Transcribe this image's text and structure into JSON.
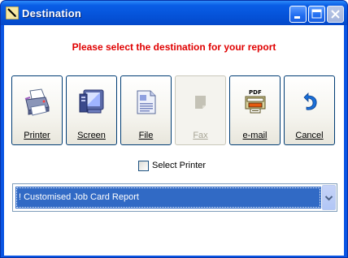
{
  "window": {
    "title": "Destination",
    "colors": {
      "titlebar": "#0553d9",
      "prompt": "#e00000",
      "selection": "#316ac5"
    }
  },
  "prompt": "Please select the destination for your report",
  "buttons": [
    {
      "label": "Printer",
      "icon": "printer-icon",
      "enabled": true
    },
    {
      "label": "Screen",
      "icon": "monitor-icon",
      "enabled": true
    },
    {
      "label": "File",
      "icon": "file-icon",
      "enabled": true
    },
    {
      "label": "Fax",
      "icon": "fax-icon",
      "enabled": false
    },
    {
      "label": "e-mail",
      "icon": "pdf-email-icon",
      "enabled": true
    },
    {
      "label": "Cancel",
      "icon": "undo-arrow-icon",
      "enabled": true
    }
  ],
  "select_printer": {
    "label": "Select Printer",
    "checked": false
  },
  "report_dropdown": {
    "selected": "! Customised Job Card Report"
  }
}
